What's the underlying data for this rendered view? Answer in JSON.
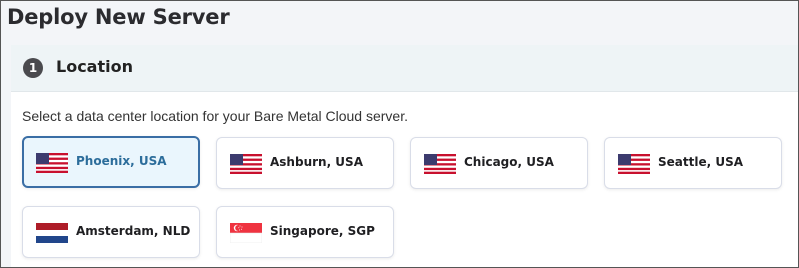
{
  "page": {
    "title": "Deploy New Server"
  },
  "location_section": {
    "step_number": "1",
    "title": "Location",
    "instructions": "Select a data center location for your Bare Metal Cloud server.",
    "selected": "Phoenix, USA",
    "locations": [
      {
        "label": "Phoenix, USA",
        "flag": "us-flag-icon",
        "selected": true
      },
      {
        "label": "Ashburn, USA",
        "flag": "us-flag-icon",
        "selected": false
      },
      {
        "label": "Chicago, USA",
        "flag": "us-flag-icon",
        "selected": false
      },
      {
        "label": "Seattle, USA",
        "flag": "us-flag-icon",
        "selected": false
      },
      {
        "label": "Amsterdam, NLD",
        "flag": "nl-flag-icon",
        "selected": false
      },
      {
        "label": "Singapore, SGP",
        "flag": "sg-flag-icon",
        "selected": false
      }
    ]
  },
  "colors": {
    "selected_border": "#3a6ea5",
    "selected_bg": "#eaf6fd",
    "selected_text": "#2c6d9b"
  }
}
